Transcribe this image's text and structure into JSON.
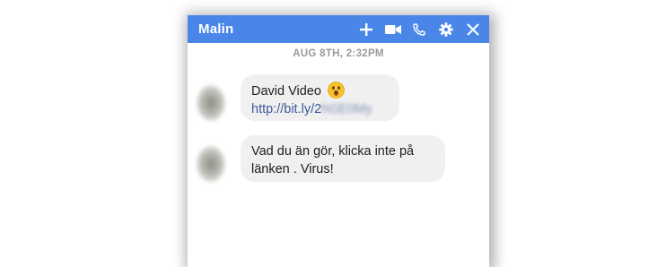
{
  "chat": {
    "title": "Malin",
    "timestamp": "AUG 8TH, 2:32PM"
  },
  "header_icons": [
    "plus-icon",
    "video-camera-icon",
    "phone-icon",
    "gear-icon",
    "close-icon"
  ],
  "messages": [
    {
      "line1": "David Video",
      "emoji": "astonished-face-emoji",
      "link_visible": "http://bit.ly/2",
      "link_blurred": "hGE0My"
    },
    {
      "line1": "Vad du än gör, klicka inte på",
      "line2": "länken . Virus!"
    }
  ],
  "colors": {
    "header": "#4a86e8",
    "bubble": "#f1f0f0",
    "link": "#3b5998",
    "timestamp": "#9a9a9a"
  }
}
